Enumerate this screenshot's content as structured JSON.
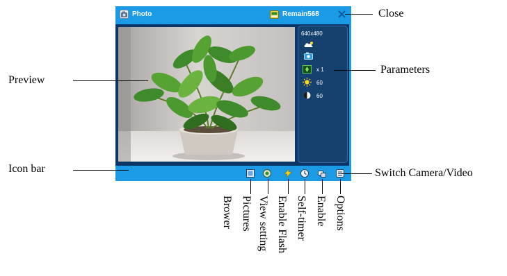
{
  "window": {
    "title": "Photo",
    "remain": "Remain568"
  },
  "parameters": {
    "resolution": "640x480",
    "zoom": "x 1",
    "brightness": "60",
    "contrast": "60"
  },
  "callouts": {
    "close": "Close",
    "preview": "Preview",
    "parameters": "Parameters",
    "icon_bar": "Icon bar",
    "switch_camera_video": "Switch Camera/Video",
    "brower": "Brower",
    "pictures": "Pictures",
    "view_setting": "View setting",
    "enable_flash": "Enable Flash",
    "self_timer": "Self-timer",
    "enable": "Enable",
    "options": "Options"
  },
  "colors": {
    "window_blue": "#1b9be6",
    "content_navy": "#0a3566"
  }
}
